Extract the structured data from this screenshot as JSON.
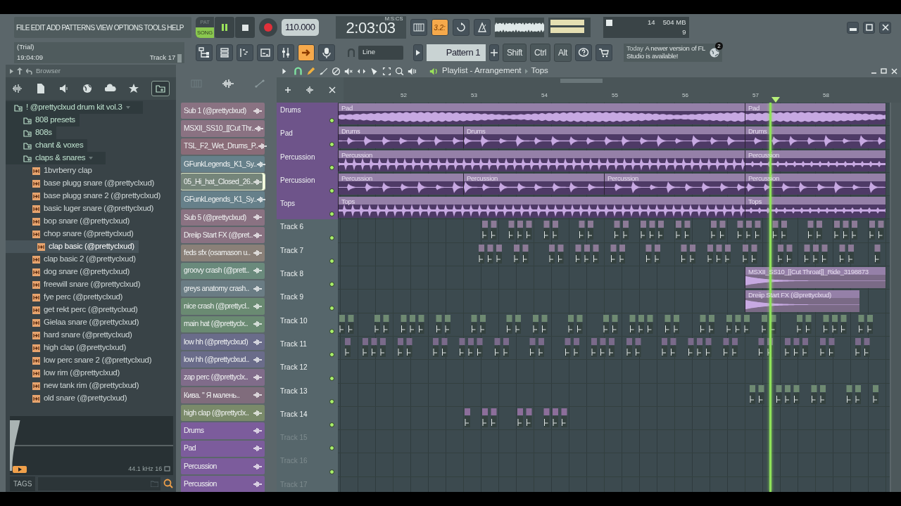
{
  "menu": [
    "FILE",
    "EDIT",
    "ADD",
    "PATTERNS",
    "VIEW",
    "OPTIONS",
    "TOOLS",
    "HELP"
  ],
  "transport": {
    "modes": [
      {
        "label": "PAT",
        "selected": false
      },
      {
        "label": "SONG",
        "selected": true
      }
    ],
    "tempo": "110.000",
    "time": "2:03:03",
    "time_unit": "M:S:CS",
    "countdown": "3.2:"
  },
  "cpu": {
    "polyphony": "14",
    "memory": "504 MB",
    "cores": "9"
  },
  "hint": {
    "title": "(Trial)",
    "clock": "19:04:09",
    "target": "Track 17"
  },
  "snap": "Line",
  "pattern": "Pattern 1",
  "keys": [
    "Shift",
    "Ctrl",
    "Alt"
  ],
  "news": {
    "day": "Today",
    "text": "A newer version of FL Studio is available!",
    "badge": "2"
  },
  "browser": {
    "title": "Browser",
    "tree": [
      {
        "label": "! @prettyclxud drum kit vol.3",
        "kind": "folder",
        "expanded": true,
        "selected": false,
        "children": [
          {
            "label": "808 presets",
            "kind": "folder",
            "expanded": false,
            "selected": false
          },
          {
            "label": "808s",
            "kind": "folder",
            "expanded": false,
            "selected": false
          },
          {
            "label": "chant & voxes",
            "kind": "folder",
            "expanded": false,
            "selected": false
          },
          {
            "label": "claps & snares",
            "kind": "folder",
            "expanded": true,
            "selected": false,
            "children": [
              {
                "label": "1bvrberry clap",
                "kind": "file",
                "selected": false
              },
              {
                "label": "base plugg snare (@prettyclxud)",
                "kind": "file",
                "selected": false
              },
              {
                "label": "base plugg snare 2 (@prettyclxud)",
                "kind": "file",
                "selected": false
              },
              {
                "label": "basic luger snare (@prettyclxud)",
                "kind": "file",
                "selected": false
              },
              {
                "label": "bop snare (@prettyclxud)",
                "kind": "file",
                "selected": false
              },
              {
                "label": "chop snare (@prettyclxud)",
                "kind": "file",
                "selected": false
              },
              {
                "label": "clap basic (@prettyclxud)",
                "kind": "file",
                "selected": true
              },
              {
                "label": "clap basic 2 (@prettyclxud)",
                "kind": "file",
                "selected": false
              },
              {
                "label": "dog snare (@prettyclxud)",
                "kind": "file",
                "selected": false
              },
              {
                "label": "freewill snare (@prettyclxud)",
                "kind": "file",
                "selected": false
              },
              {
                "label": "fye perc (@prettyclxud)",
                "kind": "file",
                "selected": false
              },
              {
                "label": "get rekt perc (@prettyclxud)",
                "kind": "file",
                "selected": false
              },
              {
                "label": "Gielaa snare (@prettyclxud)",
                "kind": "file",
                "selected": false
              },
              {
                "label": "hard snare (@prettyclxud)",
                "kind": "file",
                "selected": false
              },
              {
                "label": "high clap (@prettyclxud)",
                "kind": "file",
                "selected": false
              },
              {
                "label": "low perc snare 2 (@prettyclxud)",
                "kind": "file",
                "selected": false
              },
              {
                "label": "low rim (@prettyclxud)",
                "kind": "file",
                "selected": false
              },
              {
                "label": "new tank rim (@prettyclxud)",
                "kind": "file",
                "selected": false
              },
              {
                "label": "old snare (@prettyclxud)",
                "kind": "file",
                "selected": false
              }
            ]
          }
        ]
      }
    ],
    "preview": {
      "format": "44.1 kHz 16"
    },
    "tags_label": "TAGS"
  },
  "channels": [
    {
      "name": "Sub 1 (@prettyclxud)",
      "color": "#8a7282",
      "selected": false
    },
    {
      "name": "MSXII_SS10_[[Cut Thr..",
      "color": "#8a7282",
      "selected": false
    },
    {
      "name": "TSL_F2_Wet_Drums_P..",
      "color": "#8a6c78",
      "selected": false
    },
    {
      "name": "GFunkLegends_K1_Sy..",
      "color": "#66808a",
      "selected": false
    },
    {
      "name": "05_Hi_hat_Closed_26..",
      "color": "#75857a",
      "selected": true
    },
    {
      "name": "GFunkLegends_K1_Sy..",
      "color": "#66808a",
      "selected": false
    },
    {
      "name": "Sub 5 (@prettyclxud)",
      "color": "#8a7282",
      "selected": false
    },
    {
      "name": "Dreiip Start FX (@pret..",
      "color": "#8a7282",
      "selected": false
    },
    {
      "name": "feds sfx (osamason u..",
      "color": "#8a8078",
      "selected": false
    },
    {
      "name": "groovy crash (@prett..",
      "color": "#6a8a7c",
      "selected": false
    },
    {
      "name": "greys anatomy crash..",
      "color": "#6a7c84",
      "selected": false
    },
    {
      "name": "nice crash (@prettycl..",
      "color": "#6a8a72",
      "selected": false
    },
    {
      "name": "main hat (@prettyclx..",
      "color": "#6a8a72",
      "selected": false
    },
    {
      "name": "low hh (@prettyclxud)",
      "color": "#6a6c8a",
      "selected": false
    },
    {
      "name": "low hh (@prettyclxud..",
      "color": "#6a6c8a",
      "selected": false
    },
    {
      "name": "zap perc (@prettyclx..",
      "color": "#806c8a",
      "selected": false
    },
    {
      "name": "Кива.  \" Я малень..",
      "color": "#806c7c",
      "selected": false
    },
    {
      "name": "high clap (@prettyclx..",
      "color": "#7a8a6a",
      "selected": false
    },
    {
      "name": "Drums",
      "color": "#7c5c9c",
      "selected": false
    },
    {
      "name": "Pad",
      "color": "#7c5c9c",
      "selected": false
    },
    {
      "name": "Percussion",
      "color": "#7c5c9c",
      "selected": false
    },
    {
      "name": "Percussion",
      "color": "#7c5c9c",
      "selected": false
    }
  ],
  "playlist": {
    "title": "Playlist - Arrangement",
    "breadcrumb": "Tops",
    "ruler": [
      "52",
      "53",
      "54",
      "55",
      "56",
      "57",
      "58"
    ],
    "tracks": [
      {
        "name": "Drums",
        "color": "#6e548a",
        "on": true,
        "dimmed": false,
        "clips": [
          {
            "kind": "audio",
            "label": "Pad",
            "color": "#4e3a66"
          },
          {
            "kind": "audio",
            "label": "Pad",
            "color": "#4e3a66"
          }
        ]
      },
      {
        "name": "Pad",
        "color": "#6e548a",
        "on": true,
        "dimmed": false,
        "clips": [
          {
            "kind": "audio",
            "label": "Drums",
            "color": "#4e3a66"
          },
          {
            "kind": "audio",
            "label": "Drums",
            "color": "#4e3a66"
          },
          {
            "kind": "audio",
            "label": "Drums",
            "color": "#4e3a66"
          }
        ]
      },
      {
        "name": "Percussion",
        "color": "#6e548a",
        "on": true,
        "dimmed": false,
        "clips": [
          {
            "kind": "audio",
            "label": "Percussion",
            "color": "#4e3a66"
          },
          {
            "kind": "audio",
            "label": "Percussion",
            "color": "#4e3a66"
          }
        ]
      },
      {
        "name": "Percussion",
        "color": "#6e548a",
        "on": true,
        "dimmed": false,
        "clips": [
          {
            "kind": "audio",
            "label": "Percussion",
            "color": "#4e3a66"
          },
          {
            "kind": "audio",
            "label": "Percussion",
            "color": "#4e3a66"
          },
          {
            "kind": "audio",
            "label": "Percussion",
            "color": "#4e3a66"
          },
          {
            "kind": "audio",
            "label": "Percussion",
            "color": "#4e3a66"
          }
        ]
      },
      {
        "name": "Tops",
        "color": "#6e548a",
        "on": true,
        "dimmed": false,
        "clips": [
          {
            "kind": "audio",
            "label": "Tops",
            "color": "#4e3a66"
          },
          {
            "kind": "audio",
            "label": "Tops",
            "color": "#4e3a66"
          }
        ]
      },
      {
        "name": "Track 6",
        "color": "#56666b",
        "on": true,
        "dimmed": false,
        "clips": [
          {
            "kind": "hits",
            "color": "#8c7a96"
          }
        ]
      },
      {
        "name": "Track 7",
        "color": "#56666b",
        "on": true,
        "dimmed": false,
        "clips": [
          {
            "kind": "hits",
            "color": "#8c7a96"
          }
        ]
      },
      {
        "name": "Track 8",
        "color": "#56666b",
        "on": true,
        "dimmed": false,
        "clips": [
          {
            "kind": "audio",
            "label": "MSXII_SS10_[[Cut Throat]]_Ride_3198873",
            "color": "#7a6a86"
          }
        ]
      },
      {
        "name": "Track 9",
        "color": "#56666b",
        "on": true,
        "dimmed": false,
        "clips": [
          {
            "kind": "audio",
            "label": "Dreiip Start FX (@prettyclxud)",
            "color": "#7a6a86"
          }
        ]
      },
      {
        "name": "Track 10",
        "color": "#56666b",
        "on": true,
        "dimmed": false,
        "clips": [
          {
            "kind": "hits",
            "color": "#6f8a72"
          }
        ]
      },
      {
        "name": "Track 11",
        "color": "#56666b",
        "on": true,
        "dimmed": false,
        "clips": [
          {
            "kind": "hits",
            "color": "#7a6a8a"
          }
        ]
      },
      {
        "name": "Track 12",
        "color": "#56666b",
        "on": true,
        "dimmed": false
      },
      {
        "name": "Track 13",
        "color": "#56666b",
        "on": true,
        "dimmed": false,
        "clips": [
          {
            "kind": "hits",
            "color": "#6f8a72"
          }
        ]
      },
      {
        "name": "Track 14",
        "color": "#56666b",
        "on": true,
        "dimmed": false,
        "clips": [
          {
            "kind": "hits",
            "color": "#8c6e9a"
          }
        ]
      },
      {
        "name": "Track 15",
        "color": "#56666b",
        "on": true,
        "dimmed": true
      },
      {
        "name": "Track 16",
        "color": "#56666b",
        "on": true,
        "dimmed": true
      },
      {
        "name": "Track 17",
        "color": "#56666b",
        "dimmed": true
      }
    ]
  }
}
